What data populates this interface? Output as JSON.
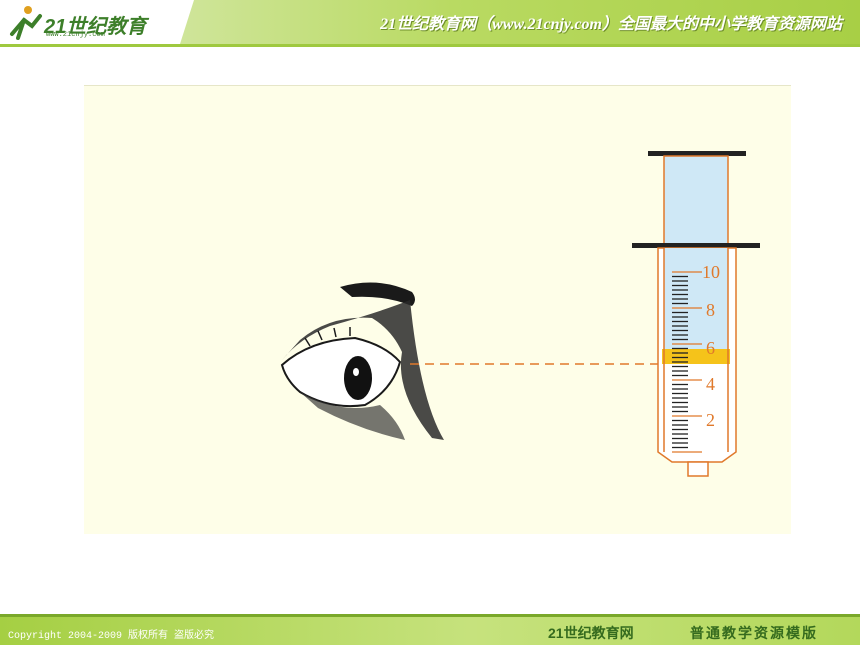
{
  "header": {
    "logo_text": "21世纪教育",
    "logo_sub": "www.21cnjy.com",
    "title": "21世纪教育网（www.21cnjy.com）全国最大的中小学教育资源网站"
  },
  "syringe": {
    "scale_labels": [
      "10",
      "8",
      "6",
      "4",
      "2"
    ],
    "liquid_level": 6,
    "scale_max": 10
  },
  "footer": {
    "copyright": "Copyright 2004-2009 版权所有 盗版必究",
    "brand": "21世纪教育网",
    "tagline": "普通教学资源模版"
  },
  "colors": {
    "accent_green": "#9fc93f",
    "syringe_outline": "#e0792b",
    "liquid": "#f5c31a",
    "barrel_fill": "#cfe8f6"
  }
}
